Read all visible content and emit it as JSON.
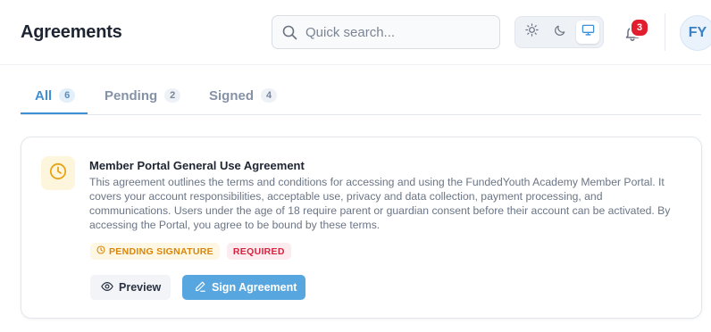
{
  "header": {
    "title": "Agreements",
    "search_placeholder": "Quick search...",
    "theme_options": [
      "light",
      "dark",
      "system"
    ],
    "active_theme": "system",
    "notifications_count": "3",
    "avatar_initials": "FY"
  },
  "tabs": [
    {
      "label": "All",
      "count": "6",
      "active": true
    },
    {
      "label": "Pending",
      "count": "2",
      "active": false
    },
    {
      "label": "Signed",
      "count": "4",
      "active": false
    }
  ],
  "agreement": {
    "icon": "clock-icon",
    "title": "Member Portal General Use Agreement",
    "description": "This agreement outlines the terms and conditions for accessing and using the FundedYouth Academy Member Portal. It covers your account responsibilities, acceptable use, privacy and data collection, payment processing, and communications. Users under the age of 18 require parent or guardian consent before their account can be activated. By accessing the Portal, you agree to be bound by these terms.",
    "status_badge": "PENDING SIGNATURE",
    "required_badge": "REQUIRED",
    "preview_label": "Preview",
    "sign_label": "Sign Agreement"
  },
  "colors": {
    "accent": "#3d8fd6",
    "primary_button": "#58a6e0",
    "pending": "#d9860a",
    "required": "#d6233f",
    "badge_red": "#e11d2e"
  }
}
